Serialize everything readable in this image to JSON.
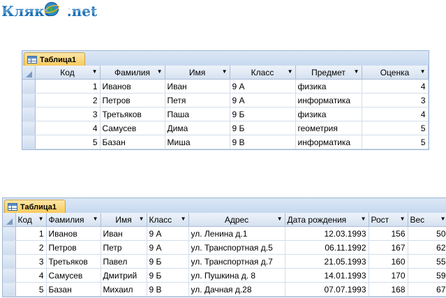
{
  "logo": {
    "text_a": "Клякс",
    "text_b": ".net"
  },
  "table1": {
    "tab_label": "Таблица1",
    "columns": [
      "Код",
      "Фамилия",
      "Имя",
      "Класс",
      "Предмет",
      "Оценка"
    ],
    "rows": [
      [
        "1",
        "Иванов",
        "Иван",
        "9 А",
        "физика",
        "4"
      ],
      [
        "2",
        "Петров",
        "Петя",
        "9 А",
        "информатика",
        "3"
      ],
      [
        "3",
        "Третьяков",
        "Паша",
        "9 Б",
        "физика",
        "4"
      ],
      [
        "4",
        "Самусев",
        "Дима",
        "9 Б",
        "геометрия",
        "5"
      ],
      [
        "5",
        "Базан",
        "Миша",
        "9 В",
        "информатика",
        "5"
      ]
    ]
  },
  "table2": {
    "tab_label": "Таблица1",
    "columns": [
      "Код",
      "Фамилия",
      "Имя",
      "Класс",
      "Адрес",
      "Дата рождения",
      "Рост",
      "Вес"
    ],
    "rows": [
      [
        "1",
        "Иванов",
        "Иван",
        "9 А",
        "ул. Ленина д.1",
        "12.03.1993",
        "156",
        "50"
      ],
      [
        "2",
        "Петров",
        "Петр",
        "9 А",
        "ул. Транспортная д.5",
        "06.11.1992",
        "167",
        "62"
      ],
      [
        "3",
        "Третьяков",
        "Павел",
        "9 Б",
        "ул. Транспортная д.7",
        "21.05.1993",
        "160",
        "55"
      ],
      [
        "4",
        "Самусев",
        "Дмитрий",
        "9 Б",
        "ул. Пушкина д. 8",
        "14.01.1993",
        "170",
        "59"
      ],
      [
        "5",
        "Базан",
        "Михаил",
        "9 В",
        "ул. Дачная д.28",
        "07.07.1993",
        "168",
        "67"
      ]
    ]
  }
}
